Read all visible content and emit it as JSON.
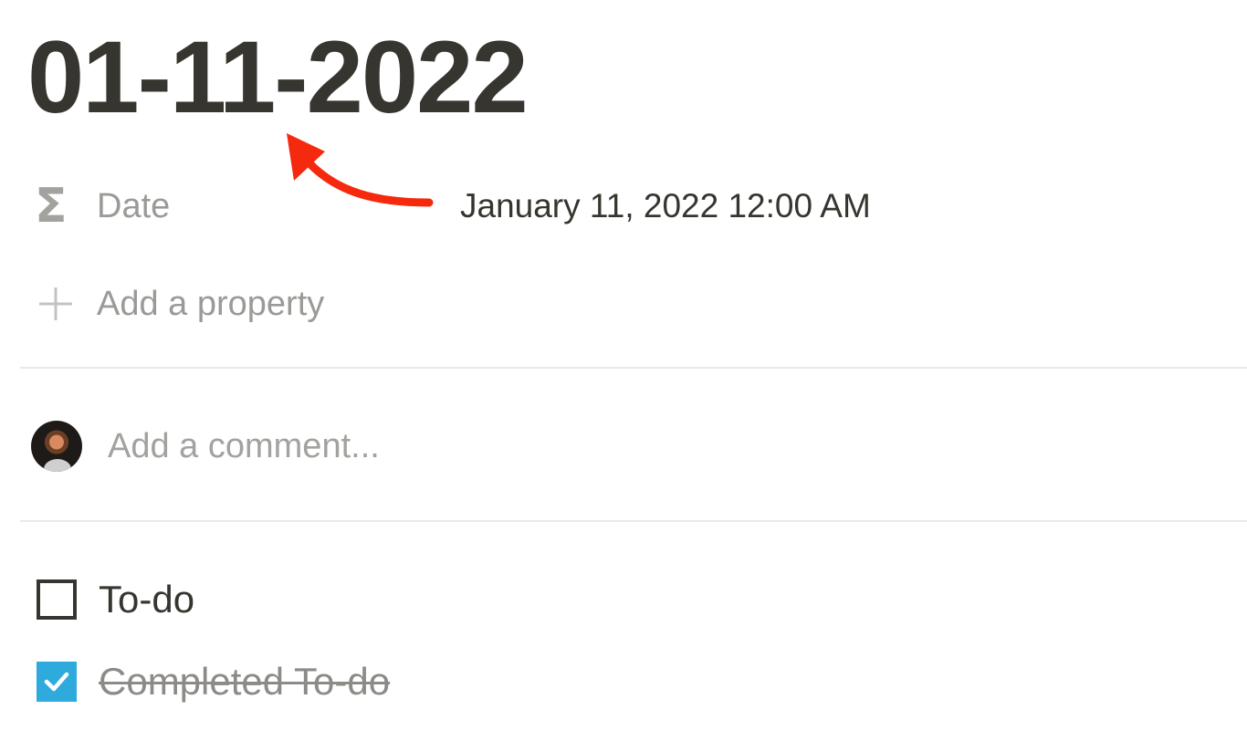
{
  "page": {
    "title": "01-11-2022"
  },
  "properties": [
    {
      "icon": "sigma-formula-icon",
      "icon_glyph": "Σ",
      "name": "Date",
      "value": "January 11, 2022 12:00 AM"
    }
  ],
  "add_property": {
    "icon": "plus-icon",
    "label": "Add a property"
  },
  "comment": {
    "avatar": "user-avatar",
    "placeholder": "Add a comment..."
  },
  "todos": [
    {
      "label": "To-do",
      "checked": false
    },
    {
      "label": "Completed To-do",
      "checked": true
    }
  ],
  "annotation": {
    "arrow_color": "#f5290e"
  },
  "colors": {
    "text": "#37352f",
    "muted": "#9b9a97",
    "checkbox_checked": "#2eaadc",
    "divider": "#e9e9e7"
  }
}
